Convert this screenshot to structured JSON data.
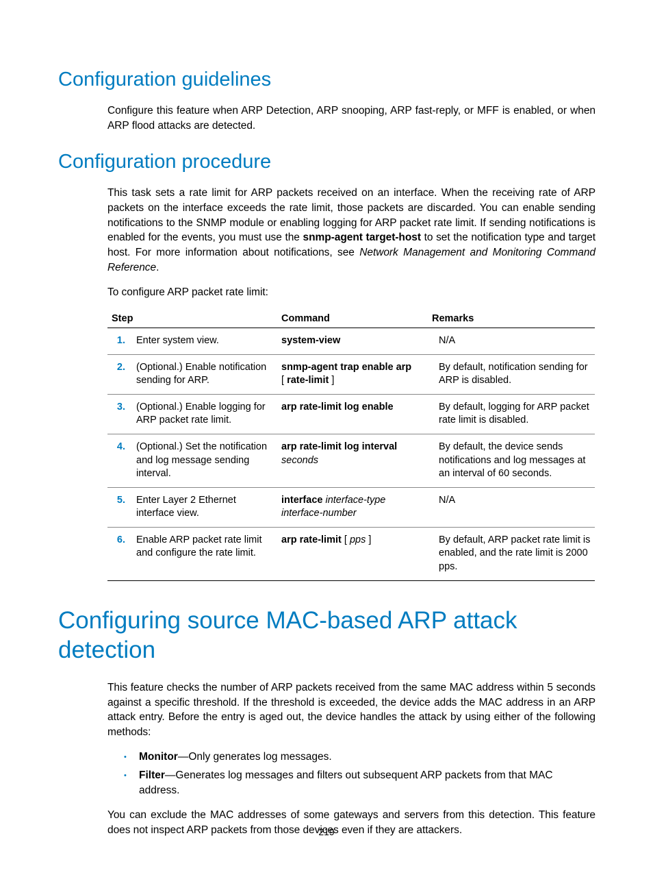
{
  "h_guidelines": "Configuration guidelines",
  "p_guidelines": "Configure this feature when ARP Detection, ARP snooping, ARP fast-reply, or MFF is enabled, or when ARP flood attacks are detected.",
  "h_procedure": "Configuration procedure",
  "p_proc_1a": "This task sets a rate limit for ARP packets received on an interface. When the receiving rate of ARP packets on the interface exceeds the rate limit, those packets are discarded. You can enable sending notifications to the SNMP module or enabling logging for ARP packet rate limit. If sending notifications is enabled for the events, you must use the ",
  "p_proc_1b": "snmp-agent target-host",
  "p_proc_1c": " to set the notification type and target host. For more information about notifications, see ",
  "p_proc_1d": "Network Management and Monitoring Command Reference",
  "p_proc_1e": ".",
  "p_proc_2": "To configure ARP packet rate limit:",
  "table": {
    "head_step": "Step",
    "head_cmd": "Command",
    "head_rem": "Remarks",
    "rows": [
      {
        "num": "1.",
        "step": "Enter system view.",
        "cmd_b1": "system-view",
        "rem": "N/A"
      },
      {
        "num": "2.",
        "step": "(Optional.) Enable notification sending for ARP.",
        "cmd_b1": "snmp-agent trap enable arp",
        "cmd_plain2": "[ ",
        "cmd_b2": "rate-limit",
        "cmd_plain3": " ]",
        "rem": "By default, notification sending for ARP is disabled."
      },
      {
        "num": "3.",
        "step": "(Optional.) Enable logging for ARP packet rate limit.",
        "cmd_b1": "arp rate-limit log enable",
        "rem": "By default, logging for ARP packet rate limit is disabled."
      },
      {
        "num": "4.",
        "step": "(Optional.) Set the notification and log message sending interval.",
        "cmd_b1": "arp rate-limit log interval",
        "cmd_i1": "seconds",
        "rem": "By default, the device sends notifications and log messages at an interval of 60 seconds."
      },
      {
        "num": "5.",
        "step": "Enter Layer 2 Ethernet interface view.",
        "cmd_b1": "interface",
        "cmd_i1": " interface-type interface-number",
        "rem": "N/A"
      },
      {
        "num": "6.",
        "step": "Enable ARP packet rate limit and configure the rate limit.",
        "cmd_b1": "arp rate-limit",
        "cmd_plain2": " [ ",
        "cmd_i1": "pps",
        "cmd_plain3": " ]",
        "rem": "By default, ARP packet rate limit is enabled, and the rate limit is 2000 pps."
      }
    ]
  },
  "h_mac": "Configuring source MAC-based ARP attack detection",
  "p_mac_1": "This feature checks the number of ARP packets received from the same MAC address within 5 seconds against a specific threshold. If the threshold is exceeded, the device adds the MAC address in an ARP attack entry. Before the entry is aged out, the device handles the attack by using either of the following methods:",
  "li1_b": "Monitor",
  "li1_t": "—Only generates log messages.",
  "li2_b": "Filter",
  "li2_t": "—Generates log messages and filters out subsequent ARP packets from that MAC address.",
  "p_mac_2": "You can exclude the MAC addresses of some gateways and servers from this detection. This feature does not inspect ARP packets from those devices even if they are attackers.",
  "page_number": "219"
}
